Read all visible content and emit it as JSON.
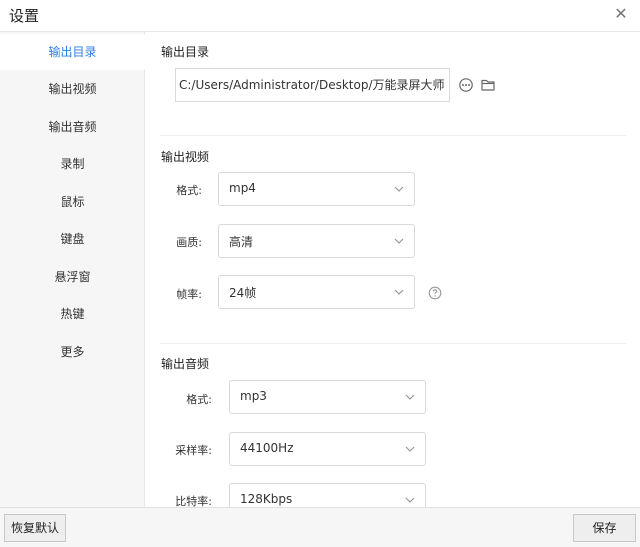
{
  "window": {
    "title": "设置",
    "close_symbol": "✕"
  },
  "sidebar": {
    "items": [
      {
        "label": "输出目录",
        "active": true
      },
      {
        "label": "输出视频",
        "active": false
      },
      {
        "label": "输出音频",
        "active": false
      },
      {
        "label": "录制",
        "active": false
      },
      {
        "label": "鼠标",
        "active": false
      },
      {
        "label": "键盘",
        "active": false
      },
      {
        "label": "悬浮窗",
        "active": false
      },
      {
        "label": "热键",
        "active": false
      },
      {
        "label": "更多",
        "active": false
      }
    ]
  },
  "output_dir": {
    "title": "输出目录",
    "path": "C:/Users/Administrator/Desktop/万能录屏大师",
    "more_icon": "more-dots-icon",
    "folder_icon": "folder-icon"
  },
  "output_video": {
    "title": "输出视频",
    "format_label": "格式:",
    "format_value": "mp4",
    "quality_label": "画质:",
    "quality_value": "高清",
    "fps_label": "帧率:",
    "fps_value": "24帧",
    "help_icon": "question-circle-icon"
  },
  "output_audio": {
    "title": "输出音频",
    "format_label": "格式:",
    "format_value": "mp3",
    "samplerate_label": "采样率:",
    "samplerate_value": "44100Hz",
    "bitrate_label": "比特率:",
    "bitrate_value": "128Kbps"
  },
  "footer": {
    "reset_label": "恢复默认",
    "save_label": "保存"
  },
  "colors": {
    "accent": "#2b7de9",
    "sidebar_bg": "#f6f6f6",
    "border": "#d9d9d9"
  }
}
